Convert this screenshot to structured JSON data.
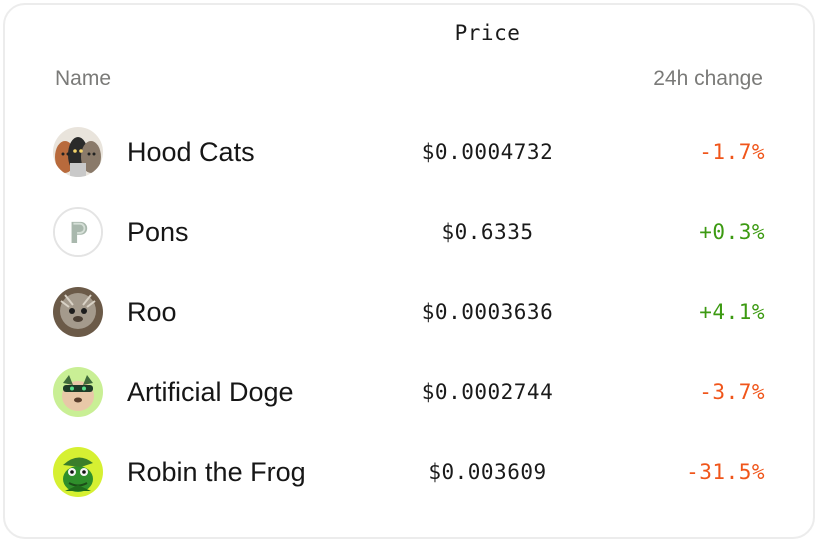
{
  "headers": {
    "name": "Name",
    "price": "Price",
    "change": "24h change"
  },
  "colors": {
    "negative": "#f0551a",
    "positive": "#3c9a12"
  },
  "rows": [
    {
      "name": "Hood Cats",
      "price": "$0.0004732",
      "change": "-1.7%",
      "direction": "negative",
      "icon": "hood-cats-avatar-icon"
    },
    {
      "name": "Pons",
      "price": "$0.6335",
      "change": "+0.3%",
      "direction": "positive",
      "icon": "pons-avatar-icon"
    },
    {
      "name": "Roo",
      "price": "$0.0003636",
      "change": "+4.1%",
      "direction": "positive",
      "icon": "roo-avatar-icon"
    },
    {
      "name": "Artificial Doge",
      "price": "$0.0002744",
      "change": "-3.7%",
      "direction": "negative",
      "icon": "artificial-doge-avatar-icon"
    },
    {
      "name": "Robin the Frog",
      "price": "$0.003609",
      "change": "-31.5%",
      "direction": "negative",
      "icon": "robin-the-frog-avatar-icon"
    }
  ]
}
